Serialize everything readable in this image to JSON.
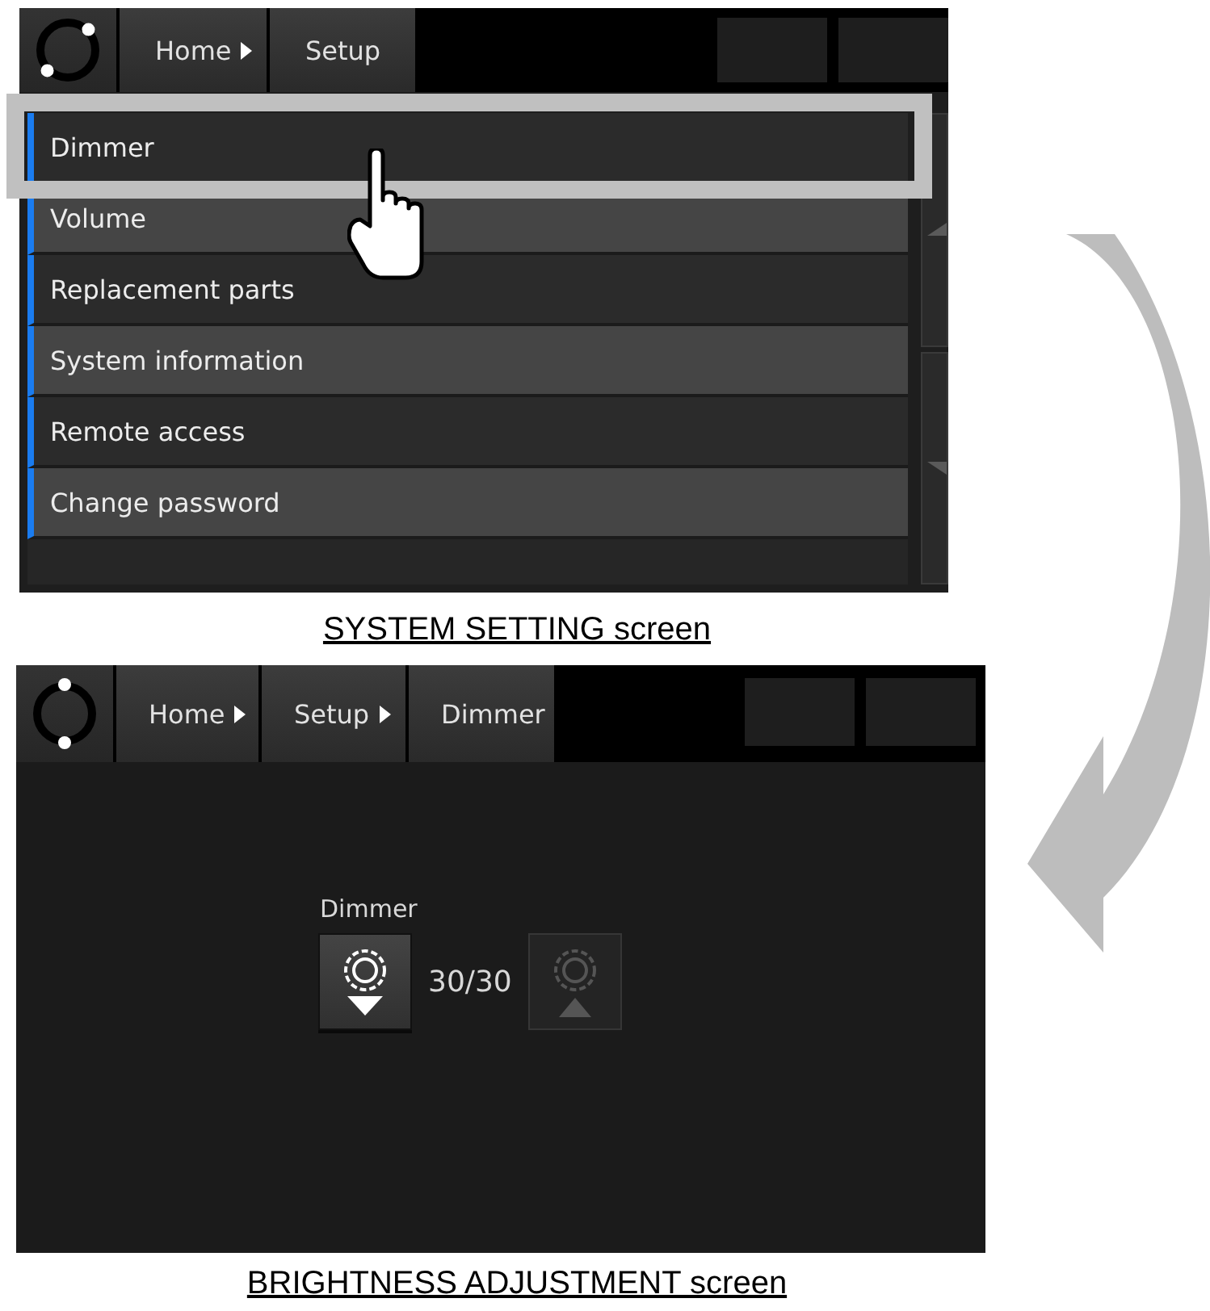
{
  "screens": [
    {
      "kind": "menu",
      "breadcrumbs": [
        "Home",
        "Setup"
      ],
      "menu_items": [
        {
          "label": "Dimmer",
          "highlighted": true
        },
        {
          "label": "Volume",
          "highlighted": false
        },
        {
          "label": "Replacement parts",
          "highlighted": false
        },
        {
          "label": "System information",
          "highlighted": false
        },
        {
          "label": "Remote access",
          "highlighted": false
        },
        {
          "label": "Change password",
          "highlighted": false
        }
      ],
      "caption": "SYSTEM SETTING screen"
    },
    {
      "kind": "dimmer",
      "breadcrumbs": [
        "Home",
        "Setup",
        "Dimmer"
      ],
      "control": {
        "label": "Dimmer",
        "value": "30/30",
        "decrease_button": {
          "disabled": false
        },
        "increase_button": {
          "disabled": true
        }
      },
      "caption": "BRIGHTNESS ADJUSTMENT screen"
    }
  ]
}
